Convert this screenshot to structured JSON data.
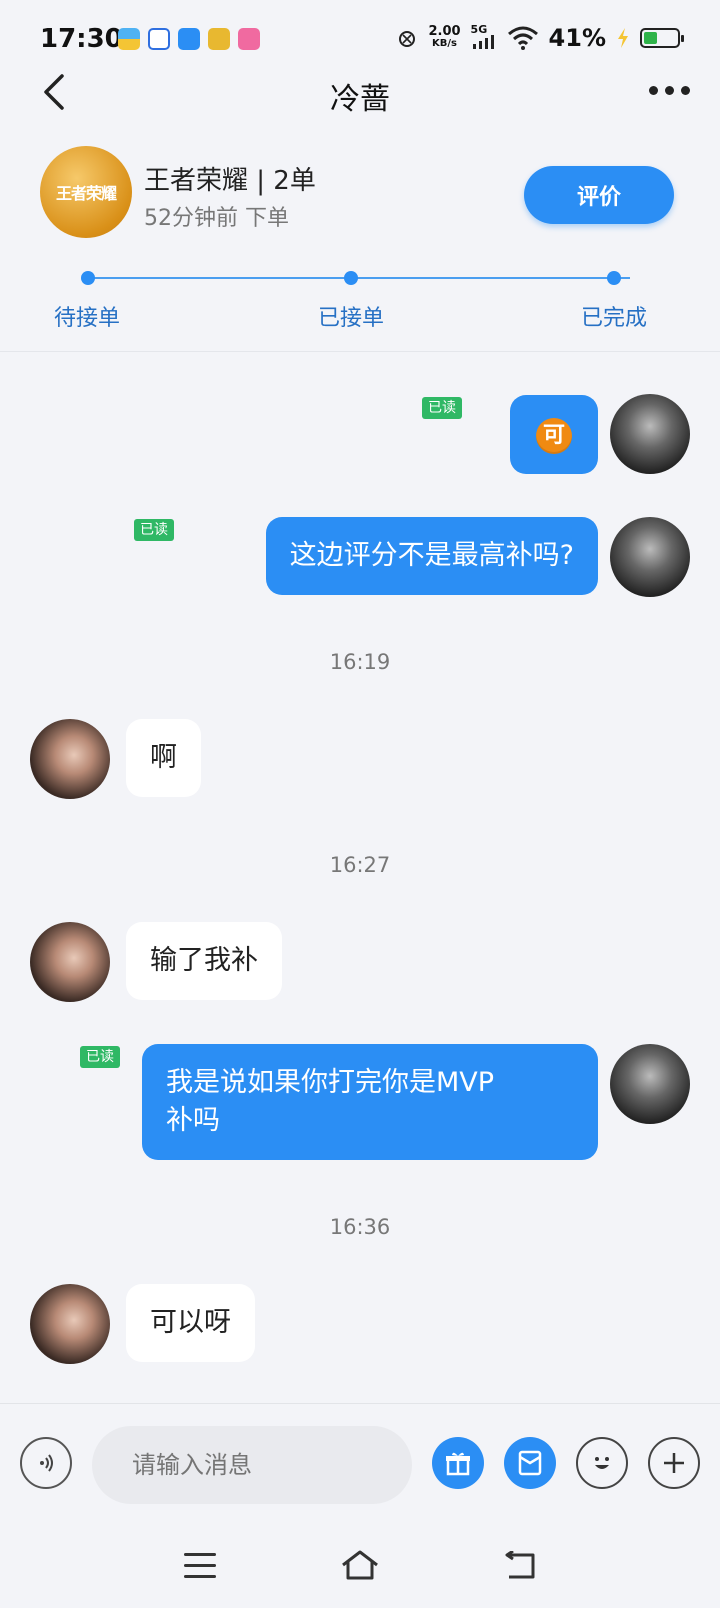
{
  "status_bar": {
    "time": "17:30",
    "net_speed": "2.00",
    "net_speed_unit": "KB/s",
    "network": "5G",
    "battery_percent": "41%",
    "battery_level": 0.41,
    "notification_app_icons": [
      "wallet-app-icon",
      "baidu-app-icon",
      "message-app-icon",
      "camera-app-icon",
      "pink-app-icon"
    ]
  },
  "header": {
    "title": "冷蔷",
    "back_icon": "chevron-left-icon",
    "more_icon": "ellipsis-icon"
  },
  "order": {
    "game_logo_text": "王者荣耀",
    "title": "王者荣耀 | 2单",
    "subtitle": "52分钟前  下单",
    "rate_button": "评价",
    "steps": [
      "待接单",
      "已接单",
      "已完成"
    ]
  },
  "chat": {
    "read_label": "已读",
    "messages": [
      {
        "type": "me",
        "content": "可",
        "read": true
      },
      {
        "type": "me",
        "content": "这边评分不是最高补吗?",
        "read": true
      },
      {
        "type": "time",
        "content": "16:19"
      },
      {
        "type": "other",
        "content": "啊"
      },
      {
        "type": "time",
        "content": "16:27"
      },
      {
        "type": "other",
        "content": "输了我补"
      },
      {
        "type": "me",
        "content": "我是说如果你打完你是MVP补吗",
        "line1": "我是说如果你打完你是MVP",
        "line2": "补吗",
        "read": true
      },
      {
        "type": "time",
        "content": "16:36"
      },
      {
        "type": "other",
        "content": "可以呀"
      }
    ]
  },
  "input_bar": {
    "placeholder": "请输入消息",
    "icons": [
      "voice-icon",
      "gift-icon",
      "red-packet-icon",
      "emoji-icon",
      "plus-icon"
    ]
  },
  "colors": {
    "accent": "#2b8ef4",
    "read_badge": "#2fb865",
    "background": "#f3f4f8"
  }
}
